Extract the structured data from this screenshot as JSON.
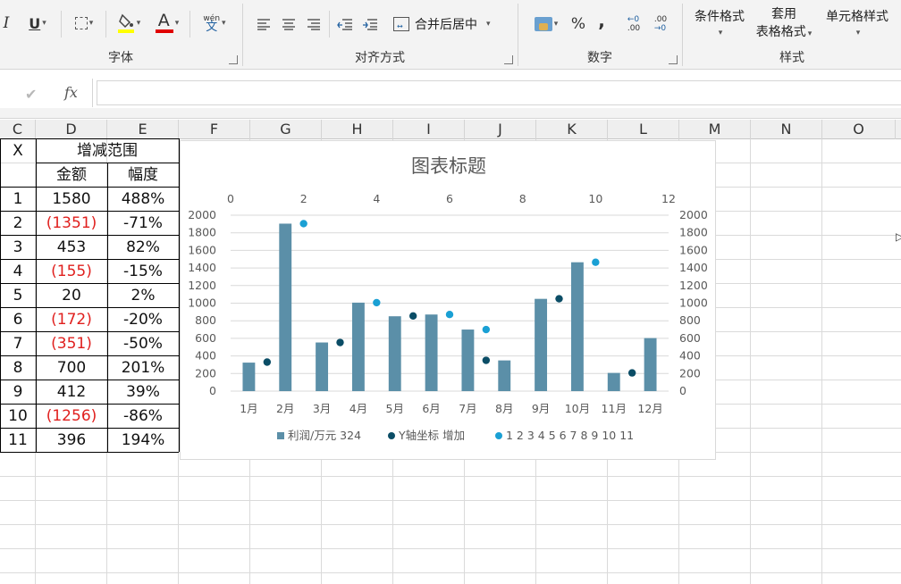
{
  "ribbon": {
    "font_group": {
      "label": "字体",
      "font_color_label": "A",
      "phonetic_top": "wén",
      "phonetic_bottom": "文",
      "underline_label": "U",
      "italic_label": "I"
    },
    "align_group": {
      "label": "对齐方式",
      "merge_label": "合并后居中"
    },
    "number_group": {
      "label": "数字",
      "percent_label": "%",
      "comma_label": ",",
      "inc_decimal": ".00",
      "dec_decimal": ".00"
    },
    "styles_group": {
      "label": "样式",
      "cond_format_label": "条件格式",
      "table_format_line1": "套用",
      "table_format_line2": "表格格式",
      "cell_style_label": "单元格样式"
    },
    "fill_color": "#ffff00",
    "font_color": "#e00000"
  },
  "formula_bar": {
    "fx_label": "fx",
    "cancel_icon": "check-icon",
    "value": ""
  },
  "columns": [
    "C",
    "D",
    "E",
    "F",
    "G",
    "H",
    "I",
    "J",
    "K",
    "L",
    "M",
    "N",
    "O"
  ],
  "table": {
    "header_x": "X",
    "header_range": "增减范围",
    "header_amount": "金额",
    "header_ratio": "幅度",
    "rows": [
      {
        "x": "1",
        "amount": "1580",
        "ratio": "488%",
        "neg": false
      },
      {
        "x": "2",
        "amount": "(1351)",
        "ratio": "-71%",
        "neg": true
      },
      {
        "x": "3",
        "amount": "453",
        "ratio": "82%",
        "neg": false
      },
      {
        "x": "4",
        "amount": "(155)",
        "ratio": "-15%",
        "neg": true
      },
      {
        "x": "5",
        "amount": "20",
        "ratio": "2%",
        "neg": false
      },
      {
        "x": "6",
        "amount": "(172)",
        "ratio": "-20%",
        "neg": true
      },
      {
        "x": "7",
        "amount": "(351)",
        "ratio": "-50%",
        "neg": true
      },
      {
        "x": "8",
        "amount": "700",
        "ratio": "201%",
        "neg": false
      },
      {
        "x": "9",
        "amount": "412",
        "ratio": "39%",
        "neg": false
      },
      {
        "x": "10",
        "amount": "(1256)",
        "ratio": "-86%",
        "neg": true
      },
      {
        "x": "11",
        "amount": "396",
        "ratio": "194%",
        "neg": false
      }
    ]
  },
  "chart_data": {
    "type": "bar",
    "title": "图表标题",
    "categories": [
      "1月",
      "2月",
      "3月",
      "4月",
      "5月",
      "6月",
      "7月",
      "8月",
      "9月",
      "10月",
      "11月",
      "12月"
    ],
    "ylim": [
      0,
      2000
    ],
    "yticks": [
      "0",
      "200",
      "400",
      "600",
      "800",
      "1000",
      "1200",
      "1400",
      "1600",
      "1800",
      "2000"
    ],
    "x2lim": [
      0,
      12
    ],
    "x2ticks": [
      "0",
      "2",
      "4",
      "6",
      "8",
      "10",
      "12"
    ],
    "bar_color": "#5b8fa8",
    "series": [
      {
        "name": "利润/万元 324",
        "kind": "bar",
        "color": "#5b8fa8",
        "values": [
          324,
          1904,
          553,
          1006,
          851,
          871,
          700,
          349,
          1049,
          1465,
          207,
          603
        ]
      },
      {
        "name": "Y轴坐标 增加",
        "kind": "scatter",
        "color": "#0b4d66",
        "points": [
          [
            1,
            330
          ],
          [
            3,
            553
          ],
          [
            5,
            855
          ],
          [
            7,
            350
          ],
          [
            9,
            1050
          ],
          [
            11,
            207
          ]
        ]
      },
      {
        "name": "1 2 3 4 5 6 7 8 9 10 11",
        "kind": "scatter",
        "color": "#1aa0d4",
        "points": [
          [
            2,
            1904
          ],
          [
            4,
            1006
          ],
          [
            6,
            871
          ],
          [
            7,
            700
          ],
          [
            10,
            1465
          ]
        ]
      }
    ],
    "legend_position": "bottom",
    "grid": true
  }
}
